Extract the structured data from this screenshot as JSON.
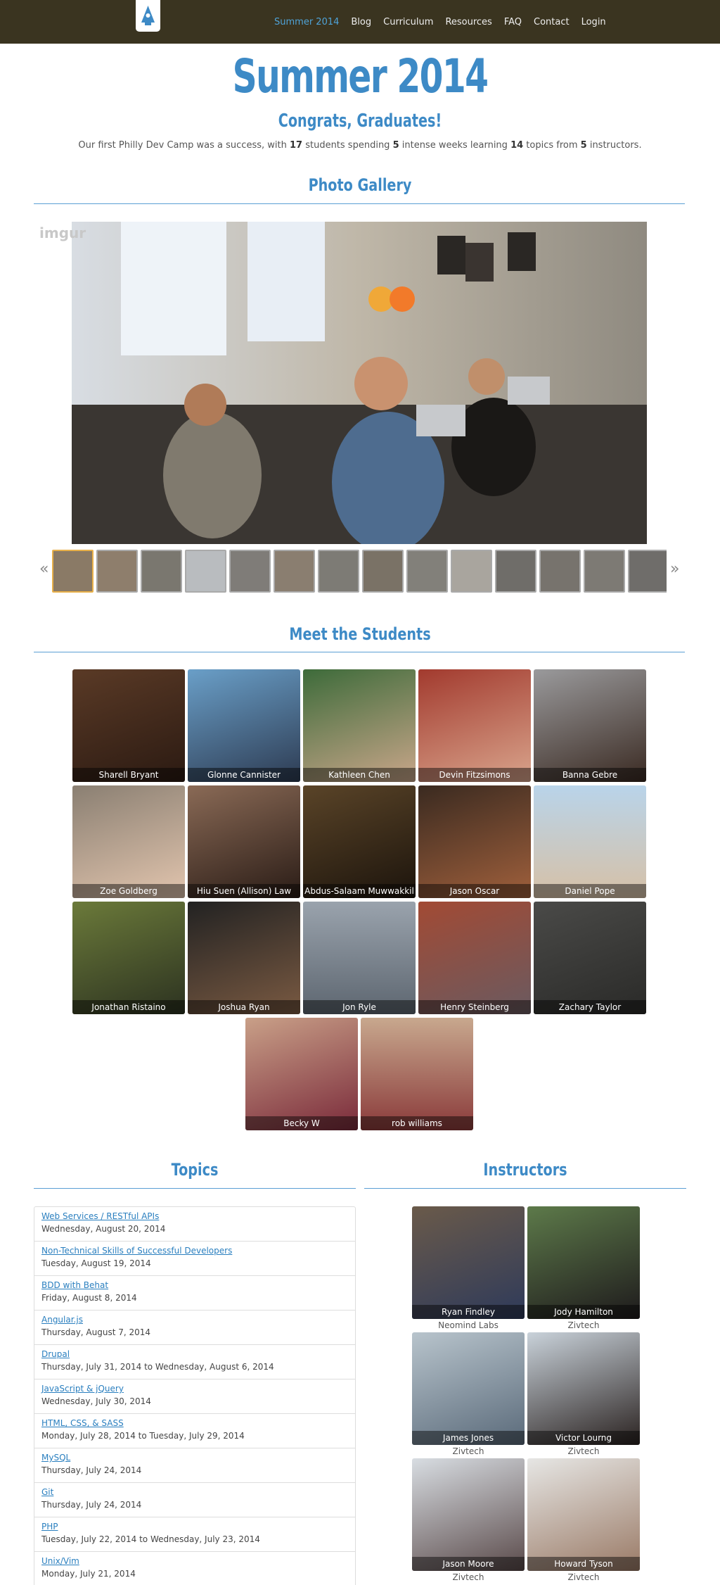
{
  "nav": {
    "items": [
      "Summer 2014",
      "Blog",
      "Curriculum",
      "Resources",
      "FAQ",
      "Contact",
      "Login"
    ],
    "active": "Summer 2014"
  },
  "header": {
    "title": "Summer 2014",
    "subtitle": "Congrats, Graduates!",
    "intro_pre": "Our first Philly Dev Camp was a success, with ",
    "students": "17",
    "intro_mid1": " students spending ",
    "weeks": "5",
    "intro_mid2": " intense weeks learning ",
    "topics": "14",
    "intro_mid3": " topics from ",
    "instructors": "5",
    "intro_post": " instructors."
  },
  "gallery": {
    "title": "Photo Gallery",
    "watermark": "imgur",
    "prev": "«",
    "next": "»"
  },
  "students": {
    "title": "Meet the Students",
    "people": [
      "Sharell Bryant",
      "Glonne Cannister",
      "Kathleen Chen",
      "Devin Fitzsimons",
      "Banna Gebre",
      "Zoe Goldberg",
      "Hiu Suen (Allison) Law",
      "Abdus-Salaam Muwwakkil",
      "Jason Oscar",
      "Daniel Pope",
      "Jonathan Ristaino",
      "Joshua Ryan",
      "Jon Ryle",
      "Henry Steinberg",
      "Zachary Taylor",
      "Becky W",
      "rob williams"
    ]
  },
  "topics": {
    "title": "Topics",
    "items": [
      {
        "name": "Web Services / RESTful APIs",
        "date": "Wednesday, August 20, 2014"
      },
      {
        "name": "Non-Technical Skills of Successful Developers",
        "date": "Tuesday, August 19, 2014"
      },
      {
        "name": "BDD with Behat",
        "date": "Friday, August 8, 2014"
      },
      {
        "name": "Angular.js",
        "date": "Thursday, August 7, 2014"
      },
      {
        "name": "Drupal",
        "date": "Thursday, July 31, 2014 to Wednesday, August 6, 2014"
      },
      {
        "name": "JavaScript & jQuery",
        "date": "Wednesday, July 30, 2014"
      },
      {
        "name": "HTML, CSS, & SASS",
        "date": "Monday, July 28, 2014 to Tuesday, July 29, 2014"
      },
      {
        "name": "MySQL",
        "date": "Thursday, July 24, 2014"
      },
      {
        "name": "Git",
        "date": "Thursday, July 24, 2014"
      },
      {
        "name": "PHP",
        "date": "Tuesday, July 22, 2014 to Wednesday, July 23, 2014"
      },
      {
        "name": "Unix/Vim",
        "date": "Monday, July 21, 2014"
      }
    ]
  },
  "instructors": {
    "title": "Instructors",
    "people": [
      {
        "name": "Ryan Findley",
        "org": "Neomind Labs"
      },
      {
        "name": "Jody Hamilton",
        "org": "Zivtech"
      },
      {
        "name": "James Jones",
        "org": "Zivtech"
      },
      {
        "name": "Victor Lourng",
        "org": "Zivtech"
      },
      {
        "name": "Jason Moore",
        "org": "Zivtech"
      },
      {
        "name": "Howard Tyson",
        "org": "Zivtech"
      }
    ]
  }
}
